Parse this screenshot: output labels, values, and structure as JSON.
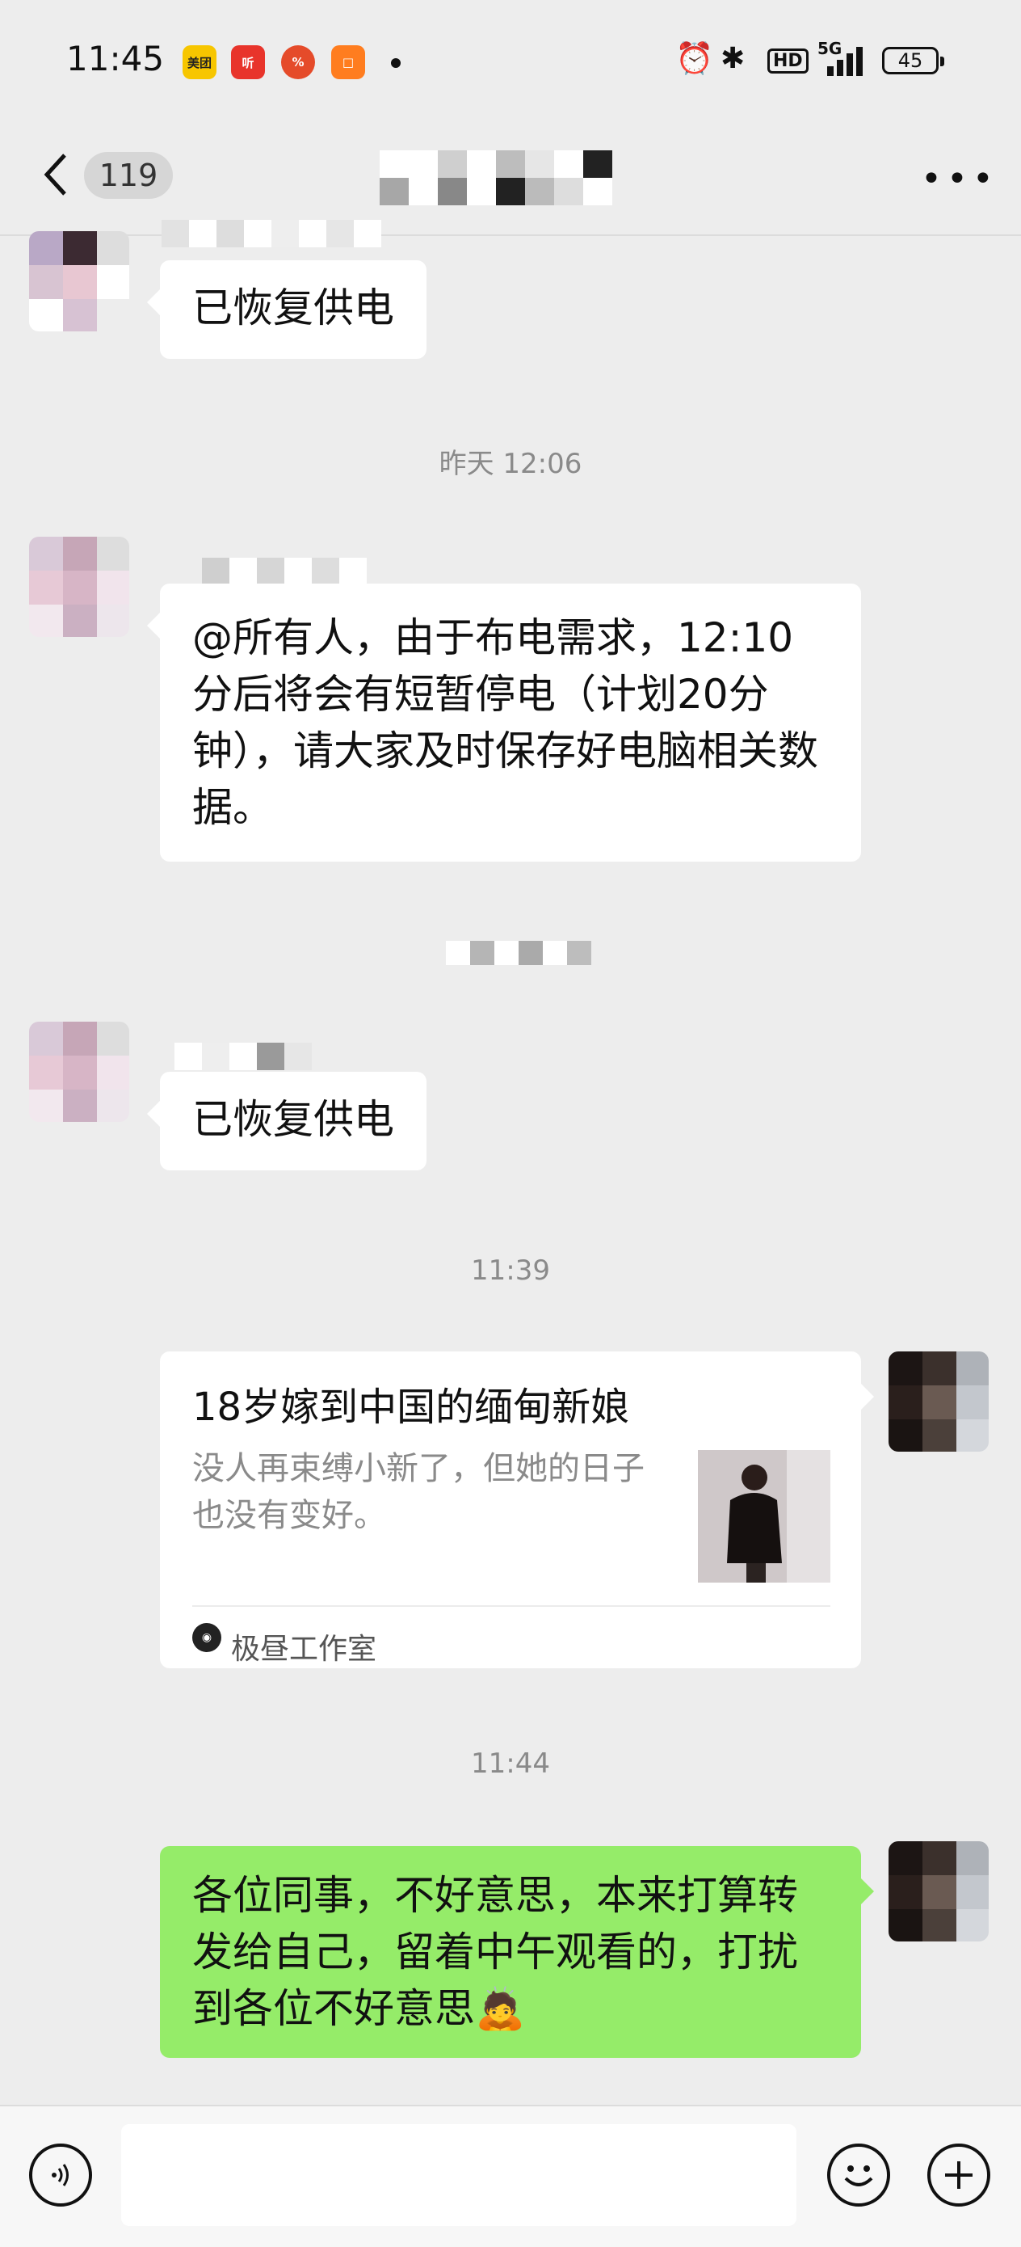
{
  "status_bar": {
    "time": "11:45",
    "apps": [
      {
        "label": "美团",
        "color": "#f7c600"
      },
      {
        "label": "听",
        "color": "#e8342b"
      },
      {
        "label": "%",
        "color": "#e54b2a"
      },
      {
        "label": "□",
        "color": "#ff7d1f"
      }
    ],
    "network": "5G",
    "hd": "HD",
    "battery": "45"
  },
  "header": {
    "unread_count": "119"
  },
  "messages": [
    {
      "type": "text",
      "side": "left",
      "text": "已恢复供电"
    },
    {
      "type": "time",
      "text": "昨天 12:06"
    },
    {
      "type": "text",
      "side": "left",
      "text": "@所有人，由于布电需求，12:10分后将会有短暂停电（计划20分钟），请大家及时保存好电脑相关数据。"
    },
    {
      "type": "text",
      "side": "left",
      "text": "已恢复供电"
    },
    {
      "type": "time",
      "text": "11:39"
    },
    {
      "type": "card",
      "side": "right",
      "title": "18岁嫁到中国的缅甸新娘",
      "desc": "没人再束缚小新了，但她的日子也没有变好。",
      "source": "极昼工作室"
    },
    {
      "type": "time",
      "text": "11:44"
    },
    {
      "type": "text",
      "side": "right",
      "text": "各位同事，不好意思，本来打算转发给自己，留着中午观看的，打扰到各位不好意思🙇"
    }
  ]
}
